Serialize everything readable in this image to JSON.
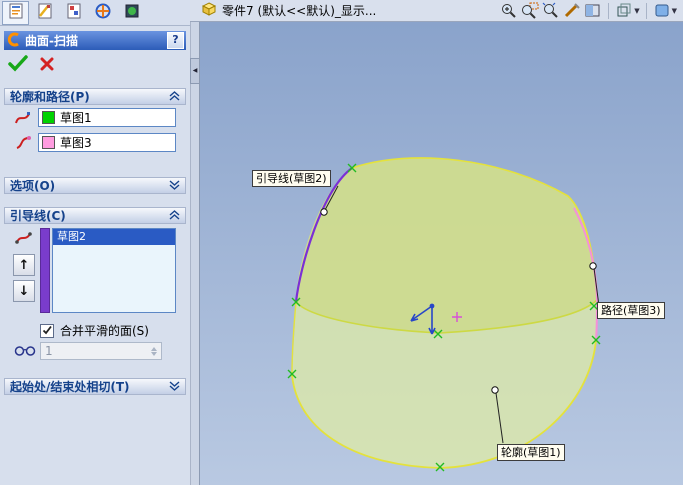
{
  "feature_tabs": {
    "icons": [
      "featuremanager-tab-icon",
      "propertymanager-tab-icon",
      "configurationmanager-tab-icon",
      "dimxpertmanager-tab-icon",
      "displaymanager-tab-icon"
    ]
  },
  "panel": {
    "title": "曲面-扫描",
    "title_icon": "sweep-surface-icon",
    "help_label": "?",
    "ok_icon": "check-icon",
    "cancel_icon": "cancel-icon",
    "sections": {
      "profile_path": {
        "label": "轮廓和路径(P)",
        "rows": [
          {
            "icon": "profile-icon",
            "value": "草图1",
            "swatch": "#00d200"
          },
          {
            "icon": "path-icon",
            "value": "草图3",
            "swatch": "#ff9ce0"
          }
        ]
      },
      "options": {
        "label": "选项(O)"
      },
      "guide_curves": {
        "label": "引导线(C)",
        "icon": "guide-curve-icon",
        "color_bar": "#7a3ccc",
        "list": {
          "selected": "草图2",
          "selection_bg": "#2a5bc4"
        },
        "up_arrow": "↑",
        "down_arrow": "↓",
        "merge_label": "合并平滑的面(S)",
        "merge_checked": true,
        "show_icon": "eyeglasses-icon",
        "spinner_value": "1"
      },
      "tangency": {
        "label": "起始处/结束处相切(T)"
      }
    }
  },
  "header": {
    "doc_icon": "part-icon",
    "doc_title": "零件7 (默认<<默认)_显示...",
    "view_tools": [
      "zoom-in-out-icon",
      "zoom-area-icon",
      "zoom-fit-icon",
      "select-wand-icon",
      "section-view-icon",
      "view-orientation-icon",
      "display-style-icon"
    ]
  },
  "viewport": {
    "background_top": "#8aa3cb",
    "background_bottom": "#b9c9e2",
    "surface": {
      "front_fill": "#dde9a8",
      "back_fill": "#d0dd8c",
      "edge_color": "#e4e23c",
      "guide_color": "#7b2fd6",
      "path_color": "#f590d8",
      "marker_color": "#22bb22",
      "origin_color": "#2847c8",
      "pointer_color": "#d84fd8"
    },
    "callouts": [
      {
        "text": "引导线(草图2)"
      },
      {
        "text": "路径(草图3)"
      },
      {
        "text": "轮廓(草图1)"
      }
    ]
  }
}
